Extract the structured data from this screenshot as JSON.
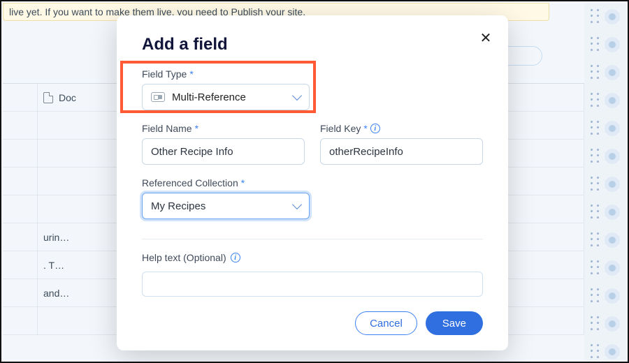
{
  "background": {
    "banner": "live yet. If you want to make them live, you need to Publish your site.",
    "doc_col_header": "Doc",
    "rows": [
      "urin…",
      ". T…",
      "and…"
    ]
  },
  "modal": {
    "title": "Add a field",
    "field_type_label": "Field Type",
    "field_type_value": "Multi-Reference",
    "field_name_label": "Field Name",
    "field_name_value": "Other Recipe Info",
    "field_key_label": "Field Key",
    "field_key_value": "otherRecipeInfo",
    "ref_label": "Referenced Collection",
    "ref_value": "My Recipes",
    "help_label": "Help text (Optional)",
    "help_value": "",
    "cancel": "Cancel",
    "save": "Save"
  }
}
